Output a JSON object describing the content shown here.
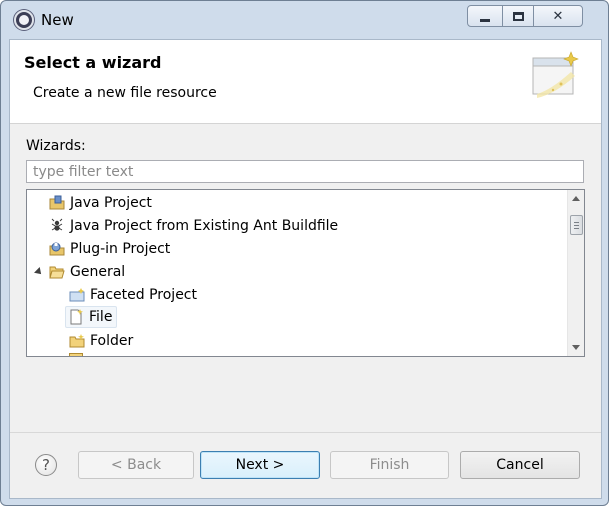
{
  "window": {
    "title": "New",
    "controls": {
      "minimize": "minimize",
      "maximize": "maximize",
      "close": "✕"
    }
  },
  "header": {
    "title": "Select a wizard",
    "description": "Create a new file resource"
  },
  "wizards_label": "Wizards:",
  "filter": {
    "placeholder": "type filter text",
    "value": ""
  },
  "tree": {
    "items": [
      {
        "label": "Java Project",
        "icon": "java-project-icon"
      },
      {
        "label": "Java Project from Existing Ant Buildfile",
        "icon": "ant-buildfile-icon"
      },
      {
        "label": "Plug-in Project",
        "icon": "plugin-project-icon"
      },
      {
        "label": "General",
        "icon": "folder-open-icon",
        "expanded": true
      },
      {
        "label": "Faceted Project",
        "icon": "faceted-project-icon"
      },
      {
        "label": "File",
        "icon": "file-icon",
        "selected": true
      },
      {
        "label": "Folder",
        "icon": "folder-icon"
      }
    ]
  },
  "buttons": {
    "help": "?",
    "back": "< Back",
    "next": "Next >",
    "finish": "Finish",
    "cancel": "Cancel"
  },
  "colors": {
    "window_frame": "#cfdceb",
    "default_button_border": "#3c7fb1",
    "selection_bg": "#f3f7fb"
  }
}
